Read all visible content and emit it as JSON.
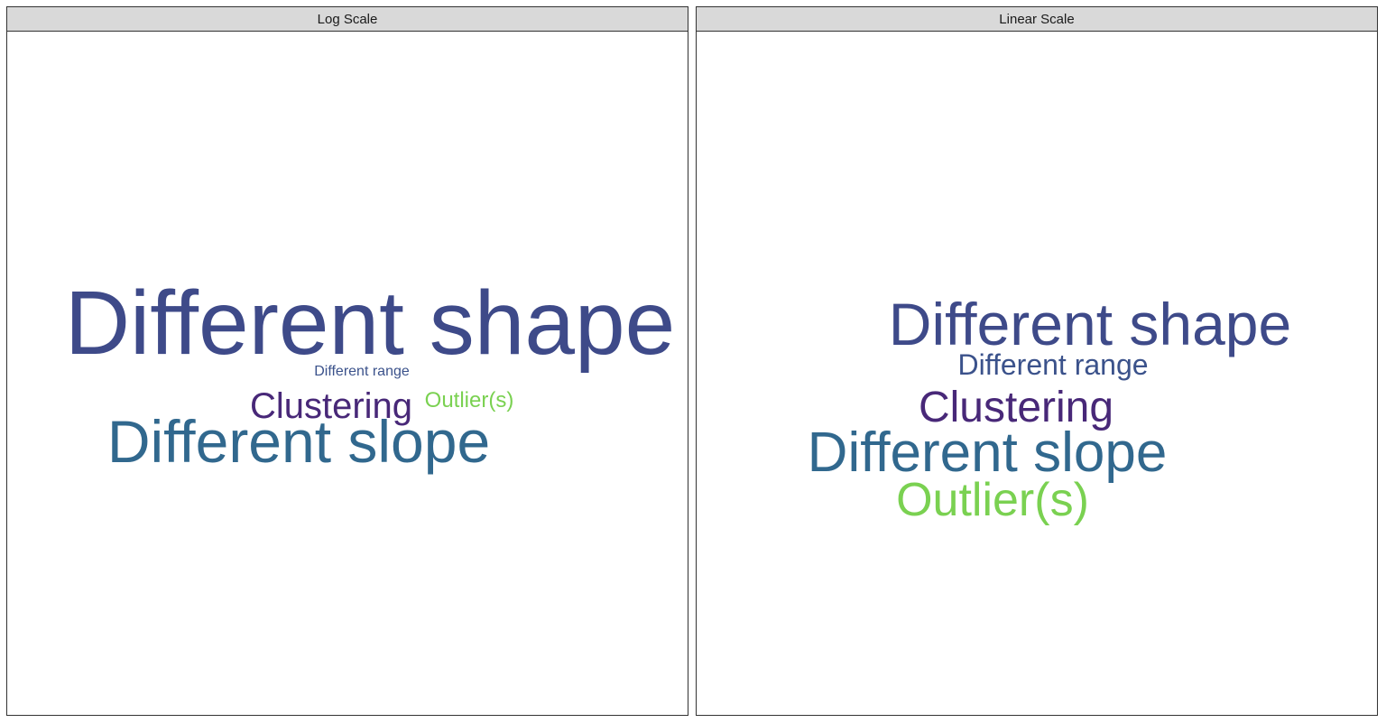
{
  "chart_data": [
    {
      "type": "wordcloud",
      "panel_title": "Log Scale",
      "words": [
        {
          "text": "Different shape",
          "color": "#3e4a89"
        },
        {
          "text": "Different slope",
          "color": "#31688e"
        },
        {
          "text": "Clustering",
          "color": "#482878"
        },
        {
          "text": "Outlier(s)",
          "color": "#7ad151"
        },
        {
          "text": "Different range",
          "color": "#3b528b"
        },
        {
          "text": "",
          "color": "#fde725"
        },
        {
          "text": "",
          "color": "#6ece58"
        },
        {
          "text": "",
          "color": "#26828e"
        },
        {
          "text": "",
          "color": "#35b779"
        },
        {
          "text": "",
          "color": "#8a8a8a"
        },
        {
          "text": "",
          "color": "#b5de2b"
        }
      ]
    },
    {
      "type": "wordcloud",
      "panel_title": "Linear Scale",
      "words": [
        {
          "text": "Different shape",
          "color": "#3e4a89"
        },
        {
          "text": "Different range",
          "color": "#3b528b"
        },
        {
          "text": "Clustering",
          "color": "#482878"
        },
        {
          "text": "Different slope",
          "color": "#31688e"
        },
        {
          "text": "Outlier(s)",
          "color": "#7ad151"
        },
        {
          "text": "",
          "color": "#26828e"
        },
        {
          "text": "",
          "color": "#1f9e89"
        },
        {
          "text": "",
          "color": "#35b779"
        },
        {
          "text": "",
          "color": "#3e4a89"
        },
        {
          "text": "",
          "color": "#fde725"
        },
        {
          "text": "",
          "color": "#6ece58"
        }
      ]
    }
  ]
}
